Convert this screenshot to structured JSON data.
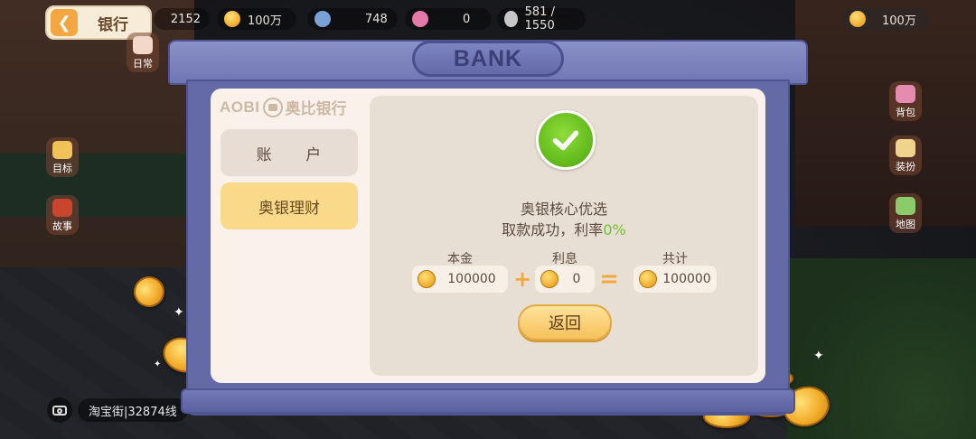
{
  "top_bar": {
    "back_label": "银行",
    "resources": [
      "2152",
      "100万",
      "748",
      "0",
      "581 / 1550"
    ],
    "currency": "100万"
  },
  "side_menu": {
    "daily": "日常",
    "goal": "目标",
    "story": "故事",
    "bag": "背包",
    "dress": "装扮",
    "map": "地图"
  },
  "street_label": "淘宝街|32874线",
  "bank": {
    "title": "BANK",
    "logo_latin": "AOBI",
    "logo_cn": "奥比银行",
    "tabs": [
      {
        "label": "账 户"
      },
      {
        "label": "奥银理财"
      }
    ],
    "result": {
      "product": "奥银核心优选",
      "status_prefix": "取款成功，利率",
      "rate": "0%",
      "principal_label": "本金",
      "interest_label": "利息",
      "total_label": "共计",
      "principal": "100000",
      "interest": "0",
      "total": "100000",
      "plus": "+",
      "equals": "=",
      "return_label": "返回"
    }
  },
  "colors": {
    "frame": "#6f76b2",
    "active_tab": "#f9d98a",
    "success": "#6cc225",
    "operator": "#f2a93a"
  }
}
